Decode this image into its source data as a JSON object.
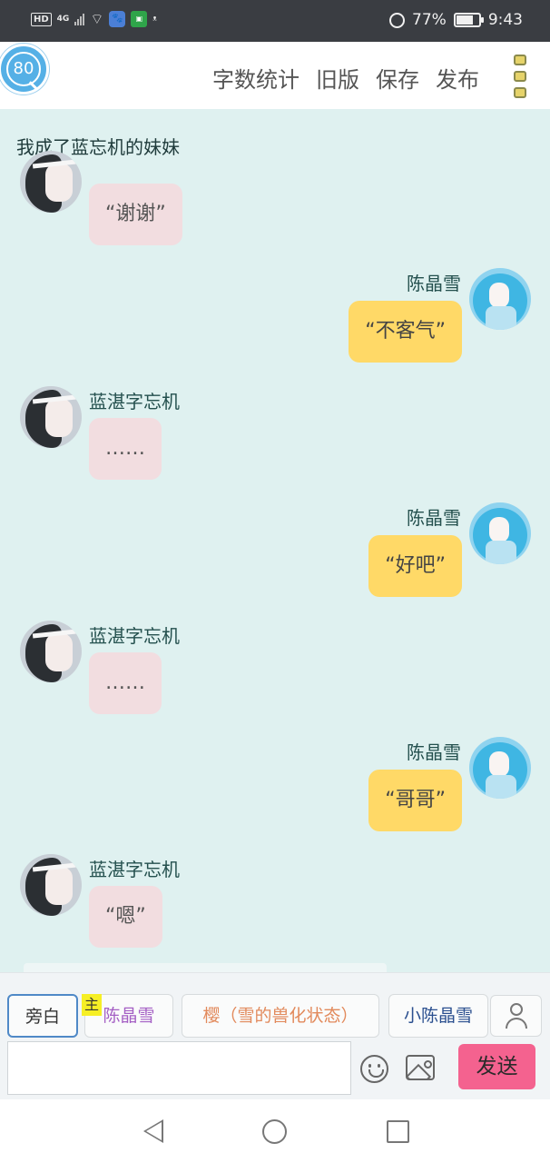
{
  "status_bar": {
    "hd": "HD",
    "network": "4G",
    "battery": "77%",
    "battery_level": 0.77,
    "time": "9:43",
    "icons": [
      "signal-icon",
      "wifi-icon",
      "baidu-app-icon",
      "wechat-app-icon",
      "alarm-icon",
      "battery-icon"
    ]
  },
  "top_bar": {
    "badge_number": "80",
    "actions": [
      "字数统计",
      "旧版",
      "保存",
      "发布"
    ],
    "menu_icon": "menu-dots-icon"
  },
  "chat": {
    "title": "我成了蓝忘机的妹妹",
    "messages": [
      {
        "side": "left",
        "name": "",
        "text": "“谢谢”"
      },
      {
        "side": "right",
        "name": "陈晶雪",
        "text": "“不客气”"
      },
      {
        "side": "left",
        "name": "蓝湛字忘机",
        "text": "……"
      },
      {
        "side": "right",
        "name": "陈晶雪",
        "text": "“好吧”"
      },
      {
        "side": "left",
        "name": "蓝湛字忘机",
        "text": "……"
      },
      {
        "side": "right",
        "name": "陈晶雪",
        "text": "“哥哥”"
      },
      {
        "side": "left",
        "name": "蓝湛字忘机",
        "text": "“嗯”"
      }
    ]
  },
  "roles": {
    "narration": "旁白",
    "main_tag": "主",
    "chen": "陈晶雪",
    "ying": "樱（雪的兽化状态）",
    "xiao": "小陈晶雪",
    "user_icon": "user-icon"
  },
  "composer": {
    "input_value": "",
    "emoji_icon": "emoji-icon",
    "image_icon": "image-icon",
    "send_label": "发送",
    "send_color": "#f4628f"
  },
  "nav": {
    "icons": [
      "back-icon",
      "home-icon",
      "recent-apps-icon"
    ]
  }
}
